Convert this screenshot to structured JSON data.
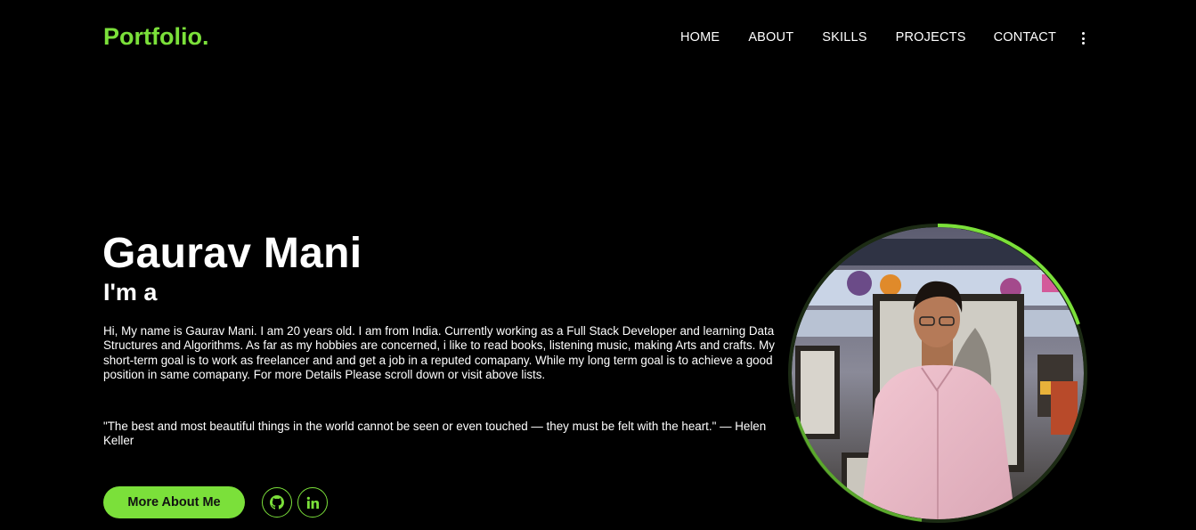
{
  "header": {
    "logo": "Portfolio.",
    "nav": [
      "HOME",
      "ABOUT",
      "SKILLS",
      "PROJECTS",
      "CONTACT"
    ]
  },
  "hero": {
    "name": "Gaurav Mani",
    "subtitle": "I'm a",
    "bio": "Hi, My name is Gaurav Mani. I am 20 years old. I am from India. Currently working as a Full Stack Developer and learning Data Structures and Algorithms. As far as my hobbies are concerned, i like to read books, listening music, making Arts and crafts. My short-term goal is to work as freelancer and and get a job in a reputed comapany. While my long term goal is to achieve a good position in same comapany. For more Details Please scroll down or visit above lists.",
    "quote": "\"The best and most beautiful things in the world cannot be seen or even touched — they must be felt with the heart.\" — Helen Keller",
    "more_button": "More About Me"
  },
  "social": [
    {
      "icon": "github-icon"
    },
    {
      "icon": "linkedin-icon"
    }
  ],
  "colors": {
    "accent": "#7be03a",
    "background": "#000000",
    "text": "#ffffff"
  }
}
